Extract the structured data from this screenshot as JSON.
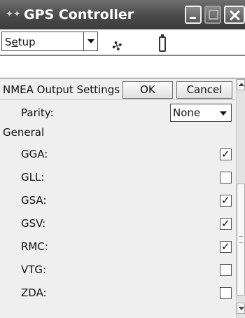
{
  "window": {
    "title": "GPS Controller",
    "app_icon": "satellite-app-icon"
  },
  "toolbar": {
    "setup_menu": {
      "prefix": "S",
      "underlined": "e",
      "suffix": "tup"
    },
    "icons": [
      "satellite-icon",
      "battery-icon"
    ]
  },
  "panel": {
    "header_title": "NMEA Output Settings",
    "ok_label": "OK",
    "cancel_label": "Cancel",
    "parity_label": "Parity:",
    "parity_value": "None",
    "section_general": "General",
    "sentences": [
      {
        "label": "GGA:",
        "checked": true,
        "mark": "✓"
      },
      {
        "label": "GLL:",
        "checked": false,
        "mark": ""
      },
      {
        "label": "GSA:",
        "checked": true,
        "mark": "✓"
      },
      {
        "label": "GSV:",
        "checked": true,
        "mark": "✓"
      },
      {
        "label": "RMC:",
        "checked": true,
        "mark": "✓"
      },
      {
        "label": "VTG:",
        "checked": false,
        "mark": ""
      },
      {
        "label": "ZDA:",
        "checked": false,
        "mark": ""
      }
    ]
  }
}
